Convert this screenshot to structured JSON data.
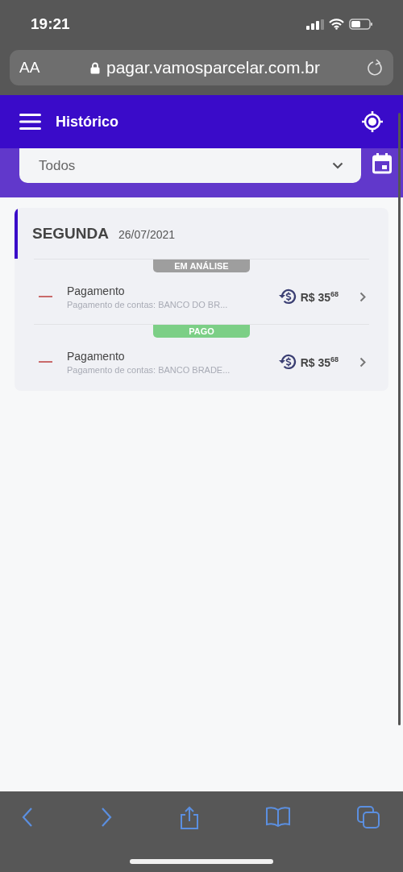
{
  "status_bar": {
    "time": "19:21"
  },
  "browser": {
    "text_size_button": "AA",
    "url": "pagar.vamosparcelar.com.br"
  },
  "app_bar": {
    "title": "Histórico"
  },
  "filter": {
    "value": "Todos"
  },
  "day_group": {
    "weekday": "SEGUNDA",
    "date": "26/07/2021",
    "transactions": [
      {
        "status": {
          "label": "EM ANÁLISE",
          "color": "#9e9e9e"
        },
        "title": "Pagamento",
        "description": "Pagamento de contas: BANCO DO BR...",
        "amount": "R$ 35$^{68}$"
      },
      {
        "status": {
          "label": "PAGO",
          "color": "#7ccf86"
        },
        "title": "Pagamento",
        "description": "Pagamento de contas: BANCO BRADE...",
        "amount": "R$ 35$^{68}$"
      }
    ]
  }
}
